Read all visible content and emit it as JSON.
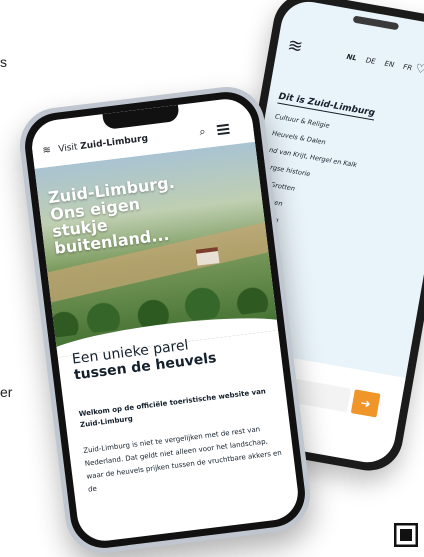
{
  "edge": {
    "left_text_1": "s",
    "left_text_2": "er"
  },
  "back_phone": {
    "languages": [
      "NL",
      "DE",
      "EN",
      "FR"
    ],
    "heart_icon": "heart-icon",
    "close_icon": "close-icon",
    "menu_title": "Dit is Zuid-Limburg",
    "menu_items": [
      "Cultuur & Religie",
      "Heuvels & Dalen",
      "nd van Krijt, Hergel en Kalk",
      "urgse historie",
      "& Grotten",
      "ducten",
      "",
      "mburg"
    ],
    "arrow_icon": "arrow-right-icon"
  },
  "front_phone": {
    "brand_prefix": "Visit",
    "brand_name": "Zuid-Limburg",
    "hero_line1": "Zuid-Limburg.",
    "hero_line2": "Ons eigen",
    "hero_line3": "stukje",
    "hero_line4": "buitenland...",
    "tagline1": "Een unieke parel",
    "tagline2": "tussen de heuvels",
    "welcome_title": "Welkom op de officiële toeristische website van Zuid-Limburg",
    "intro_text": "Zuid-Limburg is niet te vergelijken met de rest van Nederland. Dat geldt niet alleen voor het landschap, waar de heuvels prijken tussen de vruchtbare akkers en de"
  },
  "colors": {
    "accent_orange": "#f0952a",
    "ink": "#14202c",
    "back_bg": "#e9f4fa"
  }
}
